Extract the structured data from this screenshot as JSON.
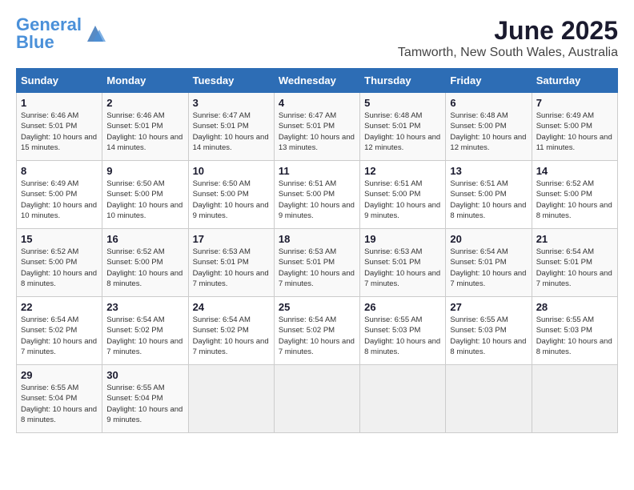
{
  "header": {
    "logo_general": "General",
    "logo_blue": "Blue",
    "month": "June 2025",
    "location": "Tamworth, New South Wales, Australia"
  },
  "calendar": {
    "days_of_week": [
      "Sunday",
      "Monday",
      "Tuesday",
      "Wednesday",
      "Thursday",
      "Friday",
      "Saturday"
    ],
    "weeks": [
      [
        {
          "day": null,
          "data": null
        },
        {
          "day": null,
          "data": null
        },
        {
          "day": null,
          "data": null
        },
        {
          "day": null,
          "data": null
        },
        {
          "day": null,
          "data": null
        },
        {
          "day": null,
          "data": null
        },
        {
          "day": null,
          "data": null
        }
      ],
      [
        {
          "day": "1",
          "sunrise": "Sunrise: 6:46 AM",
          "sunset": "Sunset: 5:01 PM",
          "daylight": "Daylight: 10 hours and 15 minutes."
        },
        {
          "day": "2",
          "sunrise": "Sunrise: 6:46 AM",
          "sunset": "Sunset: 5:01 PM",
          "daylight": "Daylight: 10 hours and 14 minutes."
        },
        {
          "day": "3",
          "sunrise": "Sunrise: 6:47 AM",
          "sunset": "Sunset: 5:01 PM",
          "daylight": "Daylight: 10 hours and 14 minutes."
        },
        {
          "day": "4",
          "sunrise": "Sunrise: 6:47 AM",
          "sunset": "Sunset: 5:01 PM",
          "daylight": "Daylight: 10 hours and 13 minutes."
        },
        {
          "day": "5",
          "sunrise": "Sunrise: 6:48 AM",
          "sunset": "Sunset: 5:01 PM",
          "daylight": "Daylight: 10 hours and 12 minutes."
        },
        {
          "day": "6",
          "sunrise": "Sunrise: 6:48 AM",
          "sunset": "Sunset: 5:00 PM",
          "daylight": "Daylight: 10 hours and 12 minutes."
        },
        {
          "day": "7",
          "sunrise": "Sunrise: 6:49 AM",
          "sunset": "Sunset: 5:00 PM",
          "daylight": "Daylight: 10 hours and 11 minutes."
        }
      ],
      [
        {
          "day": "8",
          "sunrise": "Sunrise: 6:49 AM",
          "sunset": "Sunset: 5:00 PM",
          "daylight": "Daylight: 10 hours and 10 minutes."
        },
        {
          "day": "9",
          "sunrise": "Sunrise: 6:50 AM",
          "sunset": "Sunset: 5:00 PM",
          "daylight": "Daylight: 10 hours and 10 minutes."
        },
        {
          "day": "10",
          "sunrise": "Sunrise: 6:50 AM",
          "sunset": "Sunset: 5:00 PM",
          "daylight": "Daylight: 10 hours and 9 minutes."
        },
        {
          "day": "11",
          "sunrise": "Sunrise: 6:51 AM",
          "sunset": "Sunset: 5:00 PM",
          "daylight": "Daylight: 10 hours and 9 minutes."
        },
        {
          "day": "12",
          "sunrise": "Sunrise: 6:51 AM",
          "sunset": "Sunset: 5:00 PM",
          "daylight": "Daylight: 10 hours and 9 minutes."
        },
        {
          "day": "13",
          "sunrise": "Sunrise: 6:51 AM",
          "sunset": "Sunset: 5:00 PM",
          "daylight": "Daylight: 10 hours and 8 minutes."
        },
        {
          "day": "14",
          "sunrise": "Sunrise: 6:52 AM",
          "sunset": "Sunset: 5:00 PM",
          "daylight": "Daylight: 10 hours and 8 minutes."
        }
      ],
      [
        {
          "day": "15",
          "sunrise": "Sunrise: 6:52 AM",
          "sunset": "Sunset: 5:00 PM",
          "daylight": "Daylight: 10 hours and 8 minutes."
        },
        {
          "day": "16",
          "sunrise": "Sunrise: 6:52 AM",
          "sunset": "Sunset: 5:00 PM",
          "daylight": "Daylight: 10 hours and 8 minutes."
        },
        {
          "day": "17",
          "sunrise": "Sunrise: 6:53 AM",
          "sunset": "Sunset: 5:01 PM",
          "daylight": "Daylight: 10 hours and 7 minutes."
        },
        {
          "day": "18",
          "sunrise": "Sunrise: 6:53 AM",
          "sunset": "Sunset: 5:01 PM",
          "daylight": "Daylight: 10 hours and 7 minutes."
        },
        {
          "day": "19",
          "sunrise": "Sunrise: 6:53 AM",
          "sunset": "Sunset: 5:01 PM",
          "daylight": "Daylight: 10 hours and 7 minutes."
        },
        {
          "day": "20",
          "sunrise": "Sunrise: 6:54 AM",
          "sunset": "Sunset: 5:01 PM",
          "daylight": "Daylight: 10 hours and 7 minutes."
        },
        {
          "day": "21",
          "sunrise": "Sunrise: 6:54 AM",
          "sunset": "Sunset: 5:01 PM",
          "daylight": "Daylight: 10 hours and 7 minutes."
        }
      ],
      [
        {
          "day": "22",
          "sunrise": "Sunrise: 6:54 AM",
          "sunset": "Sunset: 5:02 PM",
          "daylight": "Daylight: 10 hours and 7 minutes."
        },
        {
          "day": "23",
          "sunrise": "Sunrise: 6:54 AM",
          "sunset": "Sunset: 5:02 PM",
          "daylight": "Daylight: 10 hours and 7 minutes."
        },
        {
          "day": "24",
          "sunrise": "Sunrise: 6:54 AM",
          "sunset": "Sunset: 5:02 PM",
          "daylight": "Daylight: 10 hours and 7 minutes."
        },
        {
          "day": "25",
          "sunrise": "Sunrise: 6:54 AM",
          "sunset": "Sunset: 5:02 PM",
          "daylight": "Daylight: 10 hours and 7 minutes."
        },
        {
          "day": "26",
          "sunrise": "Sunrise: 6:55 AM",
          "sunset": "Sunset: 5:03 PM",
          "daylight": "Daylight: 10 hours and 8 minutes."
        },
        {
          "day": "27",
          "sunrise": "Sunrise: 6:55 AM",
          "sunset": "Sunset: 5:03 PM",
          "daylight": "Daylight: 10 hours and 8 minutes."
        },
        {
          "day": "28",
          "sunrise": "Sunrise: 6:55 AM",
          "sunset": "Sunset: 5:03 PM",
          "daylight": "Daylight: 10 hours and 8 minutes."
        }
      ],
      [
        {
          "day": "29",
          "sunrise": "Sunrise: 6:55 AM",
          "sunset": "Sunset: 5:04 PM",
          "daylight": "Daylight: 10 hours and 8 minutes."
        },
        {
          "day": "30",
          "sunrise": "Sunrise: 6:55 AM",
          "sunset": "Sunset: 5:04 PM",
          "daylight": "Daylight: 10 hours and 9 minutes."
        },
        {
          "day": null,
          "data": null
        },
        {
          "day": null,
          "data": null
        },
        {
          "day": null,
          "data": null
        },
        {
          "day": null,
          "data": null
        },
        {
          "day": null,
          "data": null
        }
      ]
    ]
  }
}
